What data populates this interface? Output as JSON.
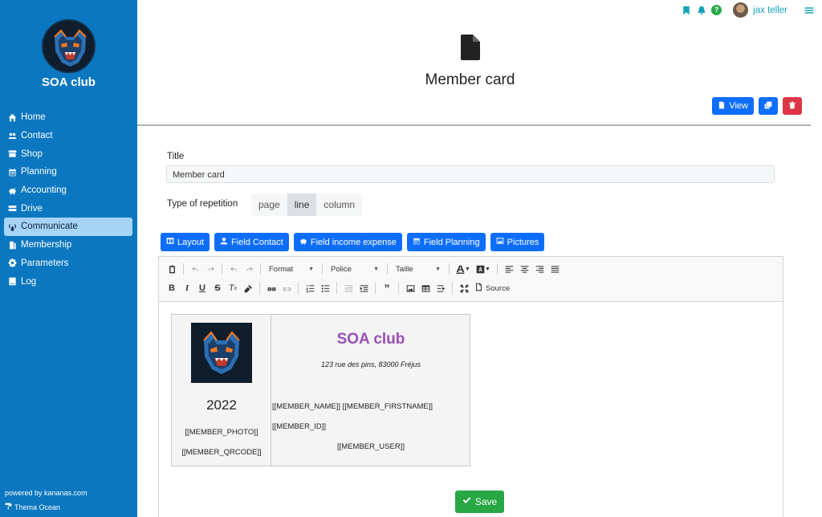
{
  "sidebar": {
    "club_name": "SOA club",
    "items": [
      {
        "label": "Home",
        "icon": "home-icon"
      },
      {
        "label": "Contact",
        "icon": "users-icon"
      },
      {
        "label": "Shop",
        "icon": "store-icon"
      },
      {
        "label": "Planning",
        "icon": "calendar-icon"
      },
      {
        "label": "Accounting",
        "icon": "piggy-bank-icon"
      },
      {
        "label": "Drive",
        "icon": "drive-icon"
      },
      {
        "label": "Communicate",
        "icon": "broadcast-icon"
      },
      {
        "label": "Membership",
        "icon": "id-card-icon"
      },
      {
        "label": "Parameters",
        "icon": "gear-icon"
      },
      {
        "label": "Log",
        "icon": "book-icon"
      }
    ],
    "active_item": "Communicate",
    "powered_by": "powered by kananas.com",
    "theme": "Thema Ocean"
  },
  "topbar": {
    "username": "jax teller",
    "help_label": "?"
  },
  "header": {
    "title": "Member card",
    "view_label": "View"
  },
  "form": {
    "title_label": "Title",
    "title_value": "Member card",
    "repetition_label": "Type of repetition",
    "repetition_options": [
      "page",
      "line",
      "column"
    ],
    "repetition_selected": "line"
  },
  "field_buttons": [
    "Layout",
    "Field Contact",
    "Field income expense",
    "Field Planning",
    "Pictures"
  ],
  "editor": {
    "format_label": "Format",
    "font_label": "Police",
    "size_label": "Taille",
    "source_label": "Source"
  },
  "card": {
    "year": "2022",
    "member_photo": "[[MEMBER_PHOTO]]",
    "member_qrcode": "[[MEMBER_QRCODE]]",
    "club_title": "SOA club",
    "address": "123 rue des pins, 83000 Fréjus",
    "name_line": "[[MEMBER_NAME]] [[MEMBER_FIRSTNAME]]",
    "id_line": "[[MEMBER_ID]]",
    "user_line": "[[MEMBER_USER]]",
    "title_color": "#9b4fb5"
  },
  "save_label": "Save",
  "colors": {
    "sidebar": "#0b77c0",
    "primary": "#0d6efd",
    "danger": "#dc3545",
    "success": "#28a745",
    "accent": "#17a2b8"
  }
}
